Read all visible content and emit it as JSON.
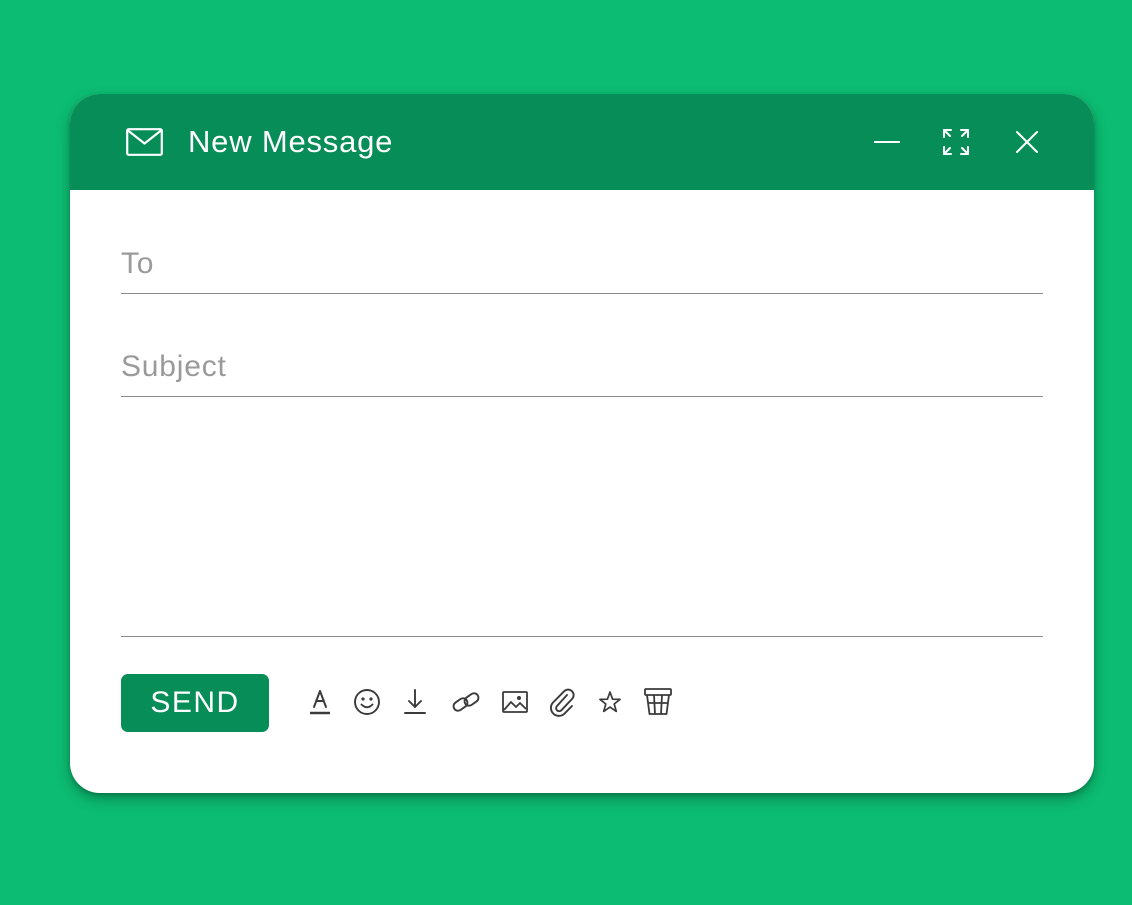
{
  "window": {
    "title": "New Message",
    "title_icon": "mail-icon",
    "controls": [
      {
        "name": "minimize-icon",
        "label": "Minimize"
      },
      {
        "name": "expand-icon",
        "label": "Expand"
      },
      {
        "name": "close-icon",
        "label": "Close"
      }
    ]
  },
  "form": {
    "to": {
      "placeholder": "To",
      "value": ""
    },
    "subject": {
      "placeholder": "Subject",
      "value": ""
    },
    "body": {
      "value": ""
    }
  },
  "toolbar": {
    "send_label": "SEND",
    "tools": [
      "text-format-icon",
      "emoji-icon",
      "download-icon",
      "link-icon",
      "image-icon",
      "attach-icon",
      "star-icon",
      "trash-icon"
    ]
  },
  "colors": {
    "background": "#0cbc72",
    "header": "#078d57",
    "send_button": "#078d57",
    "window": "#ffffff"
  }
}
